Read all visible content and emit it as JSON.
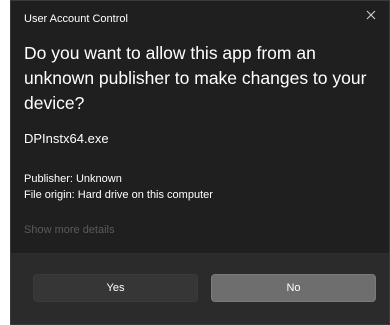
{
  "window": {
    "title": "User Account Control",
    "close_icon": "close-icon"
  },
  "prompt": {
    "headline": "Do you want to allow this app from an unknown publisher to make changes to your device?",
    "program_name": "DPInstx64.exe",
    "publisher": "Publisher: Unknown",
    "file_origin": "File origin: Hard drive on this computer",
    "show_more": "Show more details"
  },
  "buttons": {
    "yes": "Yes",
    "no": "No"
  },
  "colors": {
    "dialog_background": "#1f1f1f",
    "footer_background": "#2b2b2b",
    "yes_button": "#363636",
    "no_button": "#6e6e6e",
    "muted_link": "#5a5a5a"
  }
}
